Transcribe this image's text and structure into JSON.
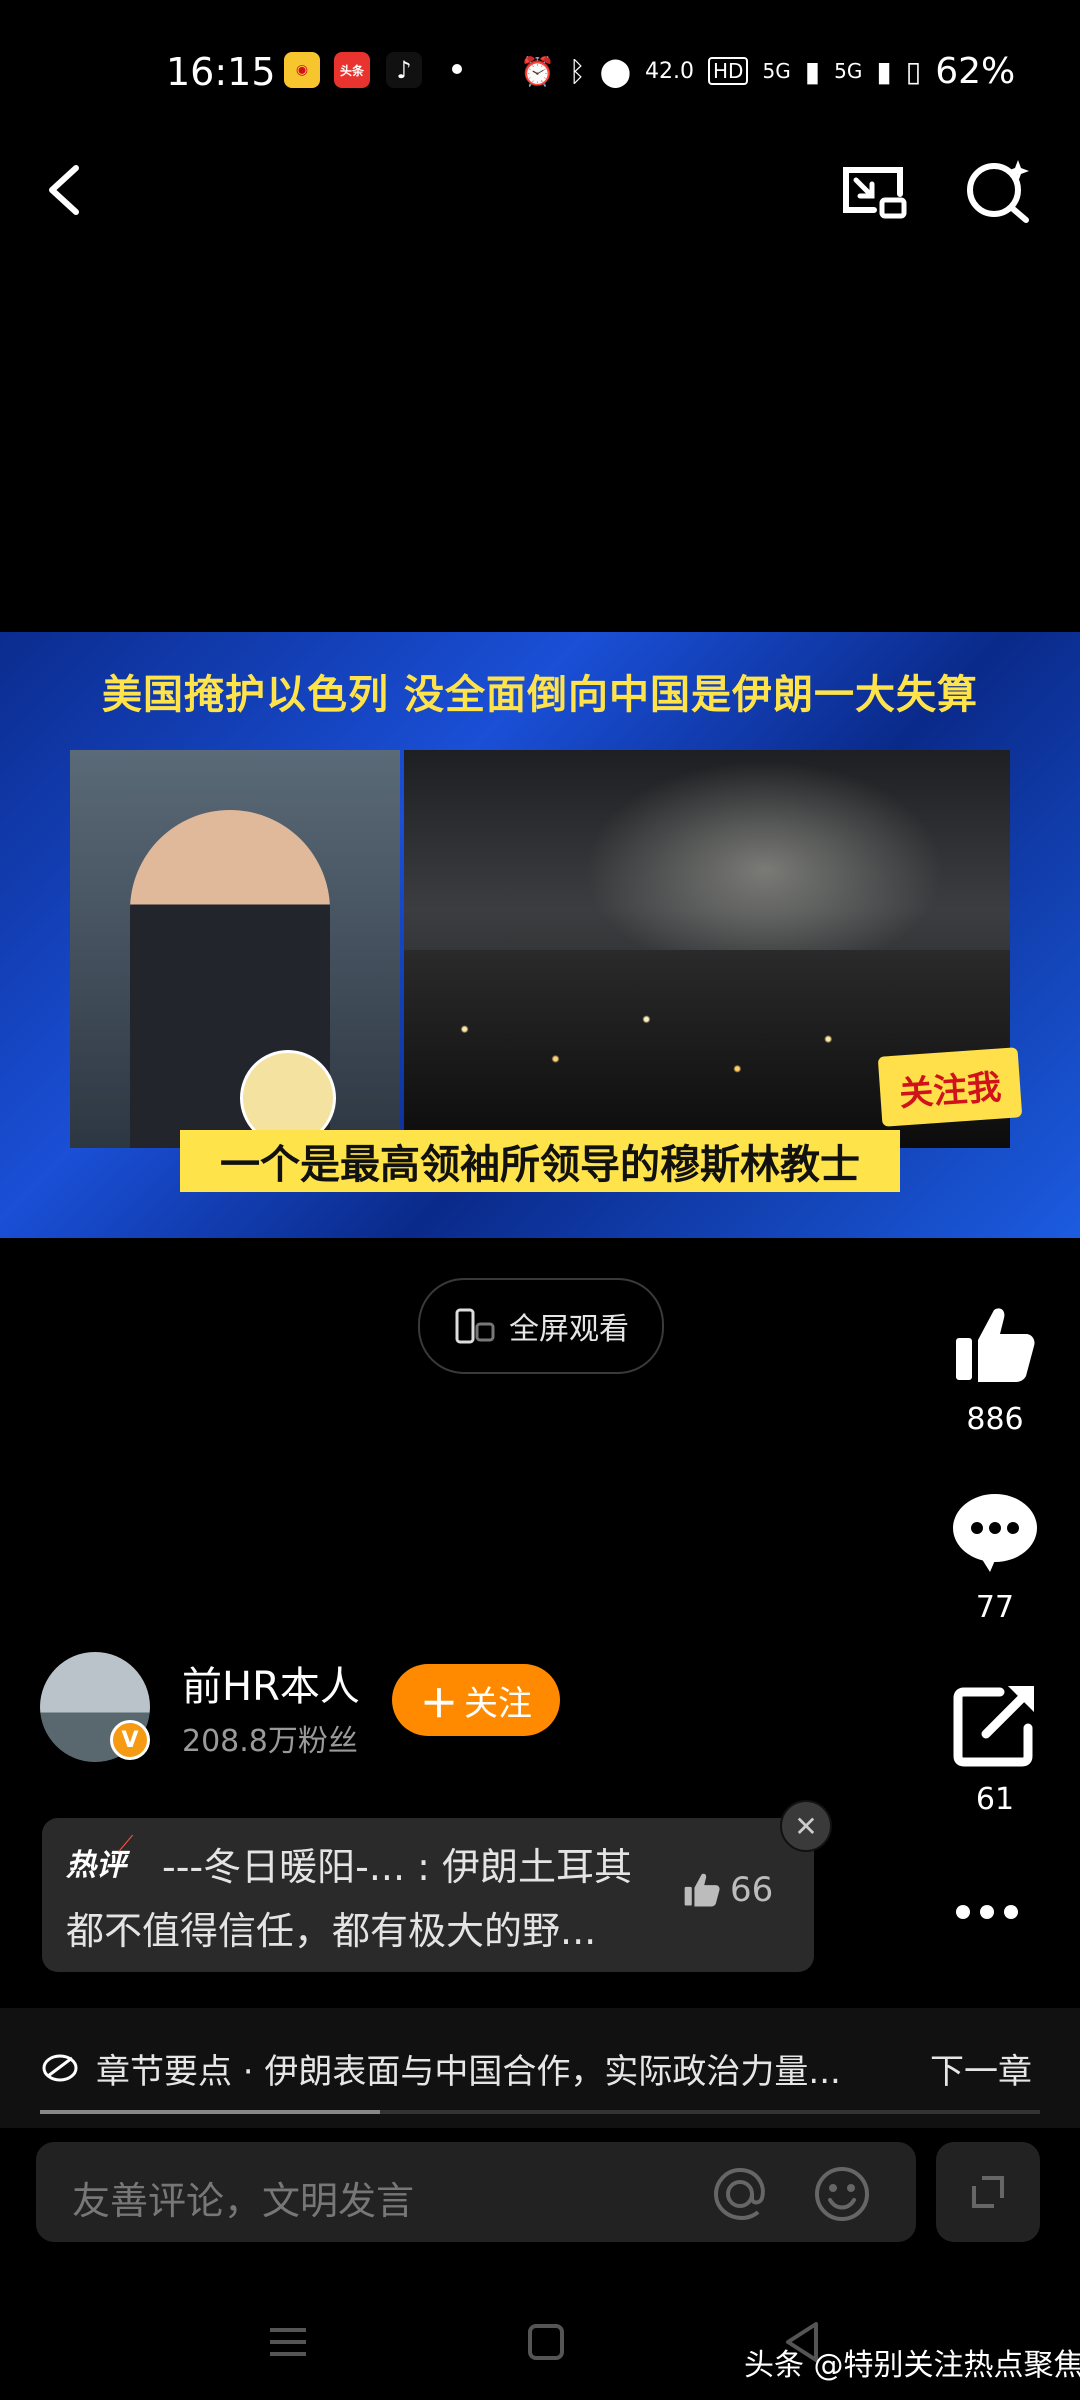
{
  "status_bar": {
    "time": "16:15",
    "app_badges": [
      "weibo",
      "头条",
      "tiktok"
    ],
    "net_speed": "42.0",
    "hd_label": "HD",
    "signal1": "5G",
    "signal2": "5G",
    "battery": "62%"
  },
  "video": {
    "headline": "美国掩护以色列 没全面倒向中国是伊朗一大失算",
    "subtitle": "一个是最高领袖所领导的穆斯林教士",
    "follow_badge": "关注我"
  },
  "fullscreen_label": "全屏观看",
  "actions": {
    "likes": "886",
    "comments": "77",
    "shares": "61"
  },
  "author": {
    "name": "前HR本人",
    "fans": "208.8万粉丝",
    "verified_mark": "V",
    "follow_label": "关注"
  },
  "hot_comment": {
    "tag": "热评",
    "line1": "---冬日暖阳-... : 伊朗土耳其",
    "line2": "都不值得信任，都有极大的野...",
    "likes": "66"
  },
  "chapter": {
    "text": "章节要点 · 伊朗表面与中国合作，实际政治力量...",
    "next_label": "下一章",
    "progress": 0.34
  },
  "comment_input": {
    "placeholder": "友善评论，文明发言"
  },
  "watermark": "头条 @特别关注热点聚焦",
  "colors": {
    "accent": "#ff8a00",
    "background": "#000000",
    "video_blue": "#1a4fd6",
    "subtitle_yellow": "#ffe34a"
  }
}
